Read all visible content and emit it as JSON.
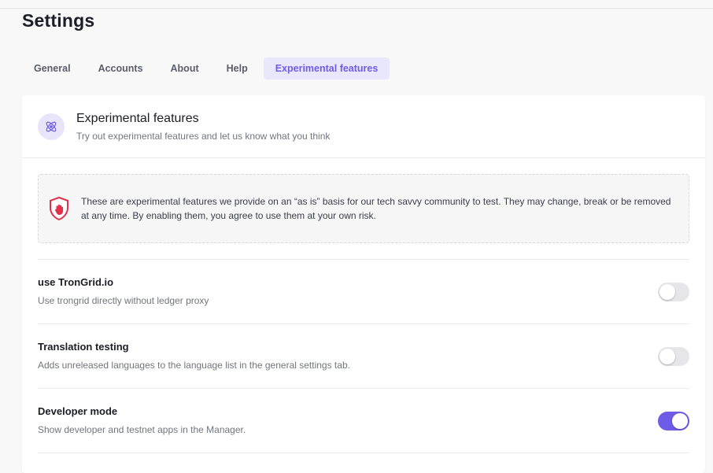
{
  "page": {
    "title": "Settings"
  },
  "tabs": [
    {
      "label": "General",
      "active": false
    },
    {
      "label": "Accounts",
      "active": false
    },
    {
      "label": "About",
      "active": false
    },
    {
      "label": "Help",
      "active": false
    },
    {
      "label": "Experimental features",
      "active": true
    }
  ],
  "section": {
    "icon": "atom-icon",
    "title": "Experimental features",
    "description": "Try out experimental features and let us know what you think"
  },
  "warning": {
    "icon": "shield-hand-icon",
    "text": "These are experimental features we provide on an “as is” basis for our tech savvy community to test. They may change, break or be removed at any time. By enabling them, you agree to use them at your own risk."
  },
  "features": [
    {
      "title": "use TronGrid.io",
      "description": "Use trongrid directly without ledger proxy",
      "enabled": false
    },
    {
      "title": "Translation testing",
      "description": "Adds unreleased languages to the language list in the general settings tab.",
      "enabled": false
    },
    {
      "title": "Developer mode",
      "description": "Show developer and testnet apps in the Manager.",
      "enabled": true
    }
  ],
  "colors": {
    "accent": "#6e5ce7",
    "accent_bg": "#e9e7fb",
    "warning_red": "#e0314b"
  }
}
